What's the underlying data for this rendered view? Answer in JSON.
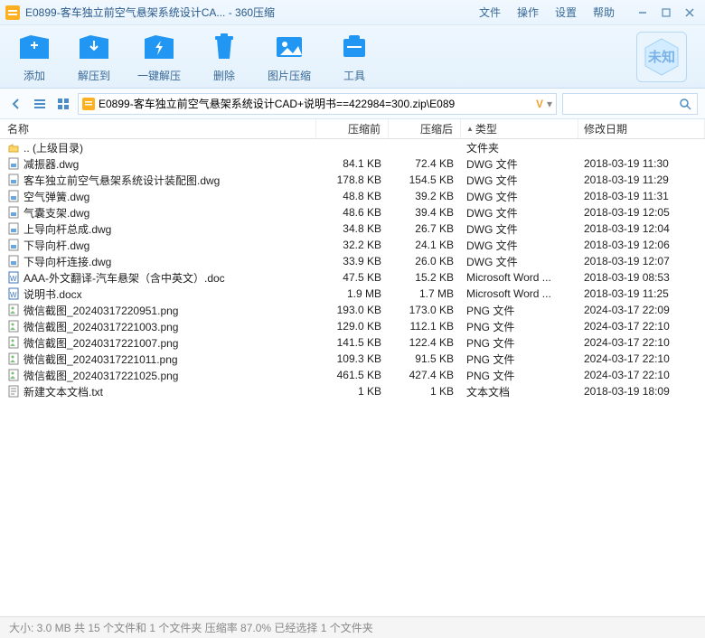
{
  "window": {
    "title": "E0899-客车独立前空气悬架系统设计CA... - 360压缩"
  },
  "menu": {
    "file": "文件",
    "operate": "操作",
    "settings": "设置",
    "help": "帮助"
  },
  "toolbar": {
    "add": "添加",
    "extract": "解压到",
    "oneclick": "一键解压",
    "delete": "删除",
    "imgcompress": "图片压缩",
    "tools": "工具",
    "badge": "未知"
  },
  "path": "E0899-客车独立前空气悬架系统设计CAD+说明书==422984=300.zip\\E089",
  "columns": {
    "name": "名称",
    "before": "压缩前",
    "after": "压缩后",
    "type": "类型",
    "date": "修改日期"
  },
  "files": [
    {
      "icon": "up",
      "name": ".. (上级目录)",
      "before": "",
      "after": "",
      "type": "文件夹",
      "date": ""
    },
    {
      "icon": "dwg",
      "name": "减振器.dwg",
      "before": "84.1 KB",
      "after": "72.4 KB",
      "type": "DWG 文件",
      "date": "2018-03-19 11:30"
    },
    {
      "icon": "dwg",
      "name": "客车独立前空气悬架系统设计装配图.dwg",
      "before": "178.8 KB",
      "after": "154.5 KB",
      "type": "DWG 文件",
      "date": "2018-03-19 11:29"
    },
    {
      "icon": "dwg",
      "name": "空气弹簧.dwg",
      "before": "48.8 KB",
      "after": "39.2 KB",
      "type": "DWG 文件",
      "date": "2018-03-19 11:31"
    },
    {
      "icon": "dwg",
      "name": "气囊支架.dwg",
      "before": "48.6 KB",
      "after": "39.4 KB",
      "type": "DWG 文件",
      "date": "2018-03-19 12:05"
    },
    {
      "icon": "dwg",
      "name": "上导向杆总成.dwg",
      "before": "34.8 KB",
      "after": "26.7 KB",
      "type": "DWG 文件",
      "date": "2018-03-19 12:04"
    },
    {
      "icon": "dwg",
      "name": "下导向杆.dwg",
      "before": "32.2 KB",
      "after": "24.1 KB",
      "type": "DWG 文件",
      "date": "2018-03-19 12:06"
    },
    {
      "icon": "dwg",
      "name": "下导向杆连接.dwg",
      "before": "33.9 KB",
      "after": "26.0 KB",
      "type": "DWG 文件",
      "date": "2018-03-19 12:07"
    },
    {
      "icon": "doc",
      "name": "AAA-外文翻译-汽车悬架（含中英文）.doc",
      "before": "47.5 KB",
      "after": "15.2 KB",
      "type": "Microsoft Word ...",
      "date": "2018-03-19 08:53"
    },
    {
      "icon": "doc",
      "name": "说明书.docx",
      "before": "1.9 MB",
      "after": "1.7 MB",
      "type": "Microsoft Word ...",
      "date": "2018-03-19 11:25"
    },
    {
      "icon": "png",
      "name": "微信截图_20240317220951.png",
      "before": "193.0 KB",
      "after": "173.0 KB",
      "type": "PNG 文件",
      "date": "2024-03-17 22:09"
    },
    {
      "icon": "png",
      "name": "微信截图_20240317221003.png",
      "before": "129.0 KB",
      "after": "112.1 KB",
      "type": "PNG 文件",
      "date": "2024-03-17 22:10"
    },
    {
      "icon": "png",
      "name": "微信截图_20240317221007.png",
      "before": "141.5 KB",
      "after": "122.4 KB",
      "type": "PNG 文件",
      "date": "2024-03-17 22:10"
    },
    {
      "icon": "png",
      "name": "微信截图_20240317221011.png",
      "before": "109.3 KB",
      "after": "91.5 KB",
      "type": "PNG 文件",
      "date": "2024-03-17 22:10"
    },
    {
      "icon": "png",
      "name": "微信截图_20240317221025.png",
      "before": "461.5 KB",
      "after": "427.4 KB",
      "type": "PNG 文件",
      "date": "2024-03-17 22:10"
    },
    {
      "icon": "txt",
      "name": "新建文本文档.txt",
      "before": "1 KB",
      "after": "1 KB",
      "type": "文本文档",
      "date": "2018-03-19 18:09"
    }
  ],
  "status": "大小: 3.0 MB 共 15 个文件和 1 个文件夹 压缩率 87.0%  已经选择 1 个文件夹"
}
